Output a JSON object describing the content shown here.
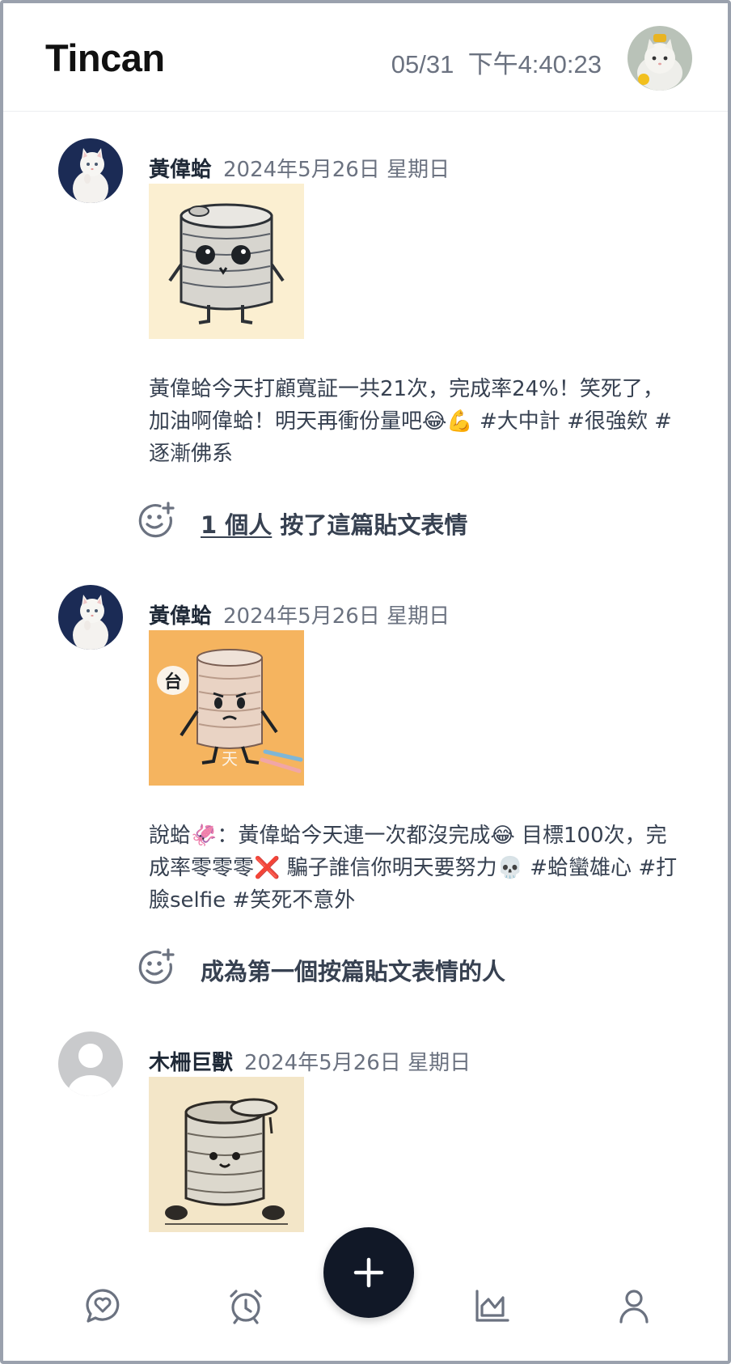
{
  "header": {
    "title": "Tincan",
    "clock": "05/31  下午4:40:23",
    "avatar_icon": "cat-avatar"
  },
  "posts": [
    {
      "author": "黃偉蛤",
      "date": "2024年5月26日 星期日",
      "text": "黃偉蛤今天打顧寬証一共21次，完成率24%！笑死了，加油啊偉蛤！明天再衝份量吧😂💪 #大中計 #很強欸 #逐漸佛系",
      "reaction_count": "1 個人",
      "reaction_suffix": " 按了這篇貼文表情"
    },
    {
      "author": "黃偉蛤",
      "date": "2024年5月26日 星期日",
      "image_glyph": "台",
      "image_caption": "天",
      "text": "說蛤🦑：黃偉蛤今天連一次都沒完成😂 目標100次，完成率零零零❌ 騙子誰信你明天要努力💀 #蛤蠻雄心 #打臉selfie #笑死不意外",
      "reaction_prompt": "成為第一個按篇貼文表情的人"
    },
    {
      "author": "木柵巨獸",
      "date": "2024年5月26日 星期日"
    }
  ],
  "nav": {
    "items": [
      "chat-heart-icon",
      "alarm-clock-icon",
      "add-post-icon",
      "chart-icon",
      "profile-icon"
    ],
    "active_color": "#111827",
    "icon_color": "#6b7280"
  },
  "colors": {
    "text_primary": "#1f2937",
    "text_muted": "#6b7280",
    "fab": "#111827"
  }
}
